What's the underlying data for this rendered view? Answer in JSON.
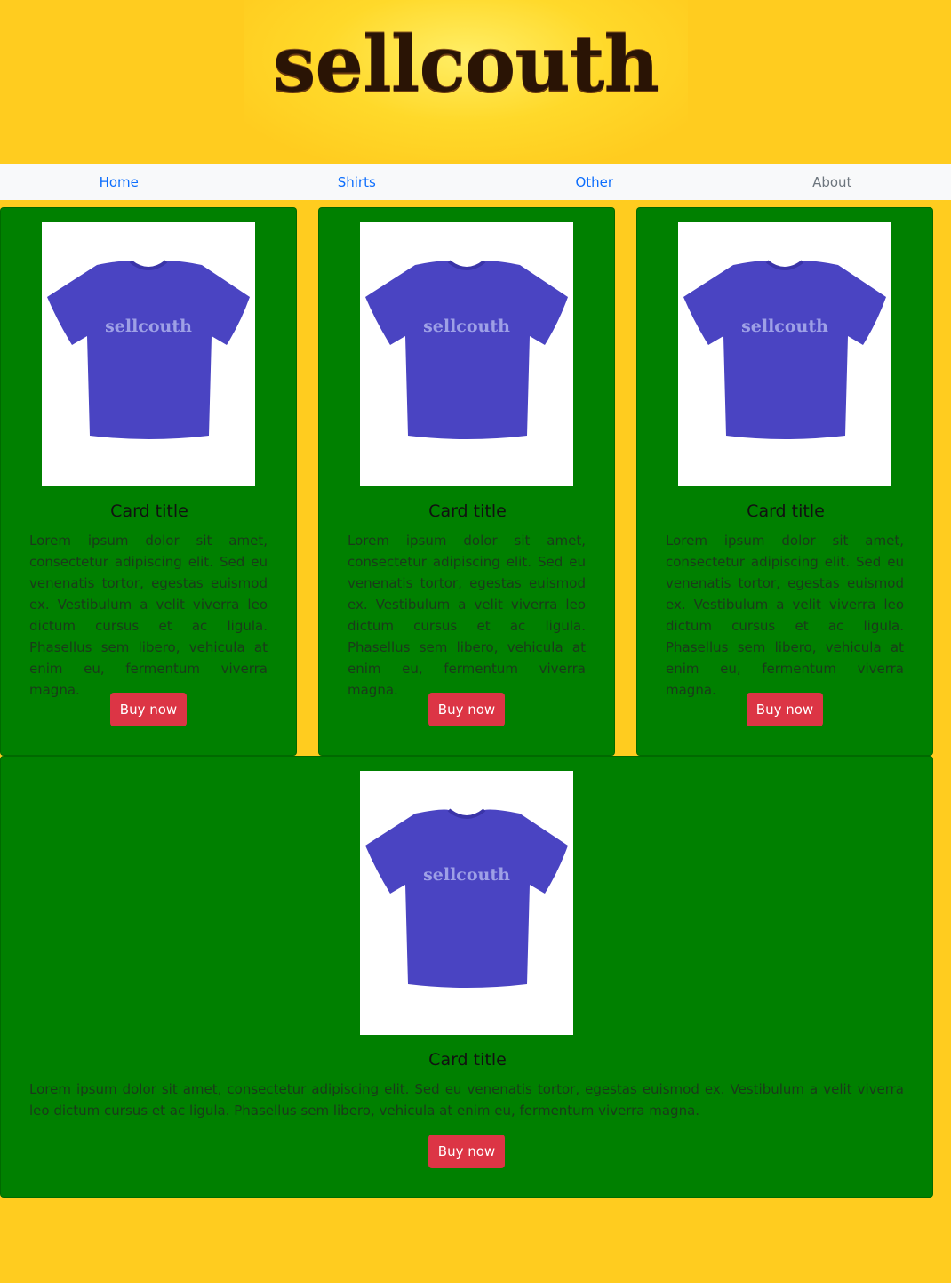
{
  "brand": {
    "logo_text": "sellcouth"
  },
  "nav": {
    "items": [
      {
        "label": "Home"
      },
      {
        "label": "Shirts"
      },
      {
        "label": "Other"
      },
      {
        "label": "About"
      }
    ]
  },
  "shirt_print": "sellcouth",
  "cards": [
    {
      "title": "Card title",
      "text": "Lorem ipsum dolor sit amet, consectetur adipiscing elit. Sed eu venenatis tortor, egestas euismod ex. Vestibulum a velit viverra leo dictum cursus et ac ligula. Phasellus sem libero, vehicula at enim eu, fermentum viverra magna.",
      "button": "Buy now"
    },
    {
      "title": "Card title",
      "text": "Lorem ipsum dolor sit amet, consectetur adipiscing elit. Sed eu venenatis tortor, egestas euismod ex. Vestibulum a velit viverra leo dictum cursus et ac ligula. Phasellus sem libero, vehicula at enim eu, fermentum viverra magna.",
      "button": "Buy now"
    },
    {
      "title": "Card title",
      "text": "Lorem ipsum dolor sit amet, consectetur adipiscing elit. Sed eu venenatis tortor, egestas euismod ex. Vestibulum a velit viverra leo dictum cursus et ac ligula. Phasellus sem libero, vehicula at enim eu, fermentum viverra magna.",
      "button": "Buy now"
    },
    {
      "title": "Card title",
      "text": "Lorem ipsum dolor sit amet, consectetur adipiscing elit. Sed eu venenatis tortor, egestas euismod ex. Vestibulum a velit viverra leo dictum cursus et ac ligula. Phasellus sem libero, vehicula at enim eu, fermentum viverra magna.",
      "button": "Buy now"
    }
  ],
  "colors": {
    "page_background": "#ffcc1f",
    "card_background": "#008000",
    "button": "#dc3545",
    "nav_link": "#0d6efd",
    "shirt": "#4a44c2"
  }
}
